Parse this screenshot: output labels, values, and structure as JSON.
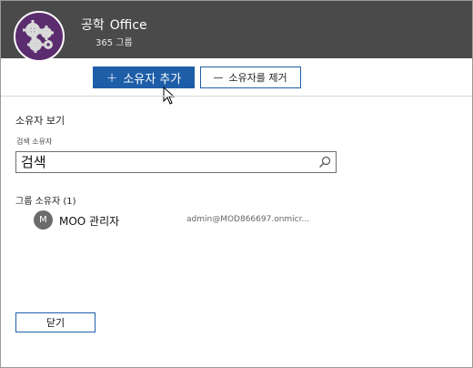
{
  "header": {
    "group_name": "공학",
    "group_app": "Office",
    "group_subtitle": "365 그룹"
  },
  "toolbar": {
    "add_owner_label": "소유자 추가",
    "remove_owner_label": "소유자를 제거"
  },
  "owners_view": {
    "title": "소유자 보기",
    "search_label": "검색 소유자",
    "search_placeholder": "검색",
    "group_owners_title": "그룹 소유자 (1)",
    "owners": [
      {
        "avatar_initial": "M",
        "name": "MOO 관리자",
        "email": "admin@MOD866697.onmicr..."
      }
    ]
  },
  "footer": {
    "close_label": "닫기"
  },
  "colors": {
    "header_bg": "#4a4a4a",
    "accent": "#1e5ea8",
    "logo_bg": "#5c2d6e"
  },
  "icons": [
    "gears-logo-icon",
    "plus-icon",
    "minus-icon",
    "search-icon",
    "mouse-cursor-icon"
  ]
}
